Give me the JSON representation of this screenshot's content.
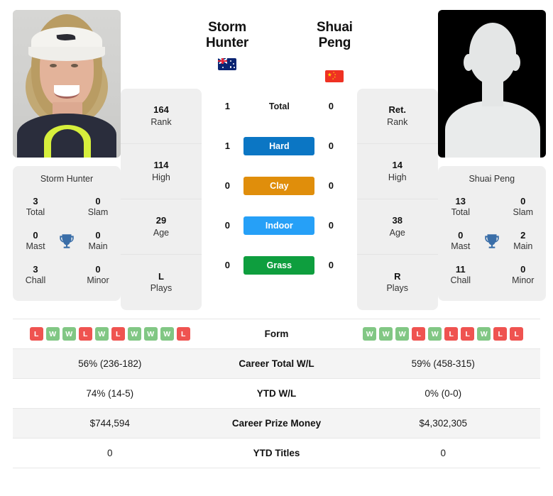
{
  "players": {
    "left": {
      "name": "Storm Hunter",
      "name_line1": "Storm",
      "name_line2": "Hunter",
      "flag": "au-flag-icon",
      "flag_title": "Australia",
      "photo": "player-photo-storm-hunter",
      "caption": "Storm Hunter",
      "titles": {
        "total": "3",
        "total_label": "Total",
        "slam": "0",
        "slam_label": "Slam",
        "mast": "0",
        "mast_label": "Mast",
        "main": "0",
        "main_label": "Main",
        "chall": "3",
        "chall_label": "Chall",
        "minor": "0",
        "minor_label": "Minor"
      },
      "stats": [
        {
          "value": "164",
          "label": "Rank"
        },
        {
          "value": "114",
          "label": "High"
        },
        {
          "value": "29",
          "label": "Age"
        },
        {
          "value": "L",
          "label": "Plays"
        }
      ],
      "surface_wins": {
        "total": "1",
        "hard": "1",
        "clay": "0",
        "indoor": "0",
        "grass": "0"
      },
      "form": [
        "L",
        "W",
        "W",
        "L",
        "W",
        "L",
        "W",
        "W",
        "W",
        "L"
      ],
      "career_total_wl": "56% (236-182)",
      "ytd_wl": "74% (14-5)",
      "career_prize_money": "$744,594",
      "ytd_titles": "0"
    },
    "right": {
      "name": "Shuai Peng",
      "name_line1": "Shuai Peng",
      "name_line2": "",
      "flag": "cn-flag-icon",
      "flag_title": "China",
      "photo": "player-photo-placeholder-silhouette",
      "caption": "Shuai Peng",
      "titles": {
        "total": "13",
        "total_label": "Total",
        "slam": "0",
        "slam_label": "Slam",
        "mast": "0",
        "mast_label": "Mast",
        "main": "2",
        "main_label": "Main",
        "chall": "11",
        "chall_label": "Chall",
        "minor": "0",
        "minor_label": "Minor"
      },
      "stats": [
        {
          "value": "Ret.",
          "label": "Rank"
        },
        {
          "value": "14",
          "label": "High"
        },
        {
          "value": "38",
          "label": "Age"
        },
        {
          "value": "R",
          "label": "Plays"
        }
      ],
      "surface_wins": {
        "total": "0",
        "hard": "0",
        "clay": "0",
        "indoor": "0",
        "grass": "0"
      },
      "form": [
        "W",
        "W",
        "W",
        "L",
        "W",
        "L",
        "L",
        "W",
        "L",
        "L"
      ],
      "career_total_wl": "59% (458-315)",
      "ytd_wl": "0% (0-0)",
      "career_prize_money": "$4,302,305",
      "ytd_titles": "0"
    }
  },
  "surfaces": [
    {
      "key": "total",
      "label": "Total",
      "color": "transparent",
      "text_color": "#1a1a1a"
    },
    {
      "key": "hard",
      "label": "Hard",
      "color": "#0b76c4",
      "text_color": "#ffffff"
    },
    {
      "key": "clay",
      "label": "Clay",
      "color": "#e08e0b",
      "text_color": "#ffffff"
    },
    {
      "key": "indoor",
      "label": "Indoor",
      "color": "#26a0f7",
      "text_color": "#ffffff"
    },
    {
      "key": "grass",
      "label": "Grass",
      "color": "#0e9e3e",
      "text_color": "#ffffff"
    }
  ],
  "trophy_icon": "trophy-icon",
  "comparison_rows": [
    {
      "label": "Form",
      "type": "form"
    },
    {
      "label": "Career Total W/L",
      "type": "text",
      "left": "56% (236-182)",
      "right": "59% (458-315)"
    },
    {
      "label": "YTD W/L",
      "type": "text",
      "left": "74% (14-5)",
      "right": "0% (0-0)"
    },
    {
      "label": "Career Prize Money",
      "type": "text",
      "left": "$744,594",
      "right": "$4,302,305"
    },
    {
      "label": "YTD Titles",
      "type": "text",
      "left": "0",
      "right": "0"
    }
  ],
  "colors": {
    "hard": "#0b76c4",
    "clay": "#e08e0b",
    "indoor": "#26a0f7",
    "grass": "#0e9e3e",
    "win_badge": "#81c784",
    "loss_badge": "#ef5350",
    "trophy": "#3a6ea8",
    "card_bg": "#efefef",
    "row_alt_bg": "#f4f4f4"
  }
}
